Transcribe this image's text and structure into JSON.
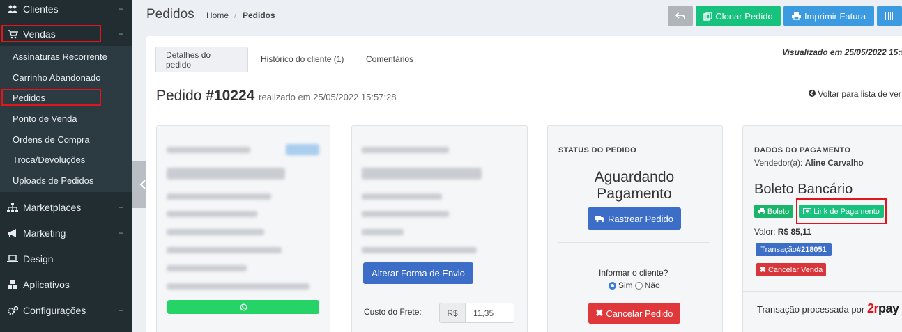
{
  "sidebar": {
    "items": [
      {
        "label": "Clientes",
        "icon": "users-icon"
      },
      {
        "label": "Vendas",
        "icon": "cart-icon"
      },
      {
        "label": "Marketplaces",
        "icon": "sitemap-icon"
      },
      {
        "label": "Marketing",
        "icon": "bullhorn-icon"
      },
      {
        "label": "Design",
        "icon": "laptop-icon"
      },
      {
        "label": "Aplicativos",
        "icon": "cubes-icon"
      },
      {
        "label": "Configurações",
        "icon": "cogs-icon"
      }
    ],
    "vendas_sub": [
      "Assinaturas Recorrente",
      "Carrinho Abandonado",
      "Pedidos",
      "Ponto de Venda",
      "Ordens de Compra",
      "Troca/Devoluções",
      "Uploads de Pedidos"
    ],
    "plus": "+",
    "minus": "−"
  },
  "header": {
    "title": "Pedidos",
    "breadcrumb_home": "Home",
    "breadcrumb_sep": "/",
    "breadcrumb_current": "Pedidos",
    "clone_label": "Clonar Pedido",
    "print_label": "Imprimir Fatura"
  },
  "tabs": [
    "Detalhes do pedido",
    "Histórico do cliente (1)",
    "Comentários"
  ],
  "viewed_text": "Visualizado em 25/05/2022 15:5",
  "order": {
    "label": "Pedido ",
    "number": "#10224",
    "placed": "realizado em 25/05/2022 15:57:28",
    "back_link": "Voltar para lista de ver"
  },
  "shipping": {
    "change_button": "Alterar Forma de Envio",
    "freight_label": "Custo do Frete:",
    "currency": "R$",
    "freight_value": "11,35"
  },
  "status": {
    "heading": "STATUS DO PEDIDO",
    "line1": "Aguardando",
    "line2": "Pagamento",
    "track_button": "Rastrear Pedido",
    "inform_question": "Informar o cliente?",
    "yes": "Sim",
    "no": "Não",
    "cancel_button": "Cancelar Pedido"
  },
  "payment": {
    "heading": "DADOS DO PAGAMENTO",
    "vendor_label": "Vendedor(a): ",
    "vendor_name": "Aline Carvalho",
    "method": "Boleto Bancário",
    "boleto_button": "Boleto",
    "link_button": "Link de Pagamento",
    "value_label": "Valor: ",
    "value": "R$ 85,11",
    "transaction_label": "Transação ",
    "transaction_id": "#218051",
    "cancel_sale_button": "Cancelar Venda",
    "processed_by": "Transação processada por",
    "logo_prefix": "2r",
    "logo_suffix": "pay"
  },
  "colors": {
    "sidebar_bg": "#222d32",
    "highlight_red": "#e3151a",
    "green": "#17c17e",
    "blue": "#3c6ec7",
    "red": "#e0373a"
  }
}
